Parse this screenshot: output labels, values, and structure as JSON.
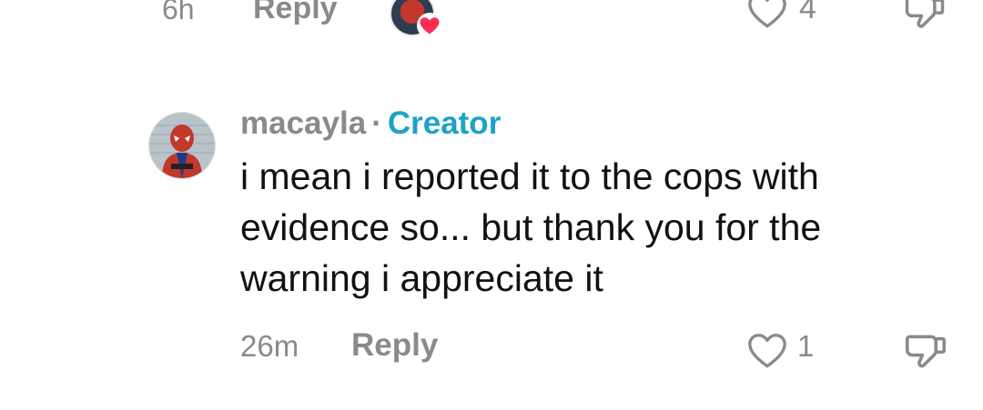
{
  "previous_comment": {
    "time": "6h",
    "reply_label": "Reply",
    "like_count": "4"
  },
  "comment": {
    "username": "macayla",
    "separator": "·",
    "badge": "Creator",
    "text": "i mean i reported it to the cops with evidence so... but thank you for the warning i appreciate it",
    "time": "26m",
    "reply_label": "Reply",
    "like_count": "1"
  },
  "colors": {
    "muted_text": "#8a8a8a",
    "creator_badge": "#1ba3c6",
    "body_text": "#111111",
    "heart_badge": "#fe2c55"
  },
  "icons": {
    "like": "heart-outline-icon",
    "dislike": "thumbs-down-icon",
    "creator_liked": "red-heart-icon"
  }
}
